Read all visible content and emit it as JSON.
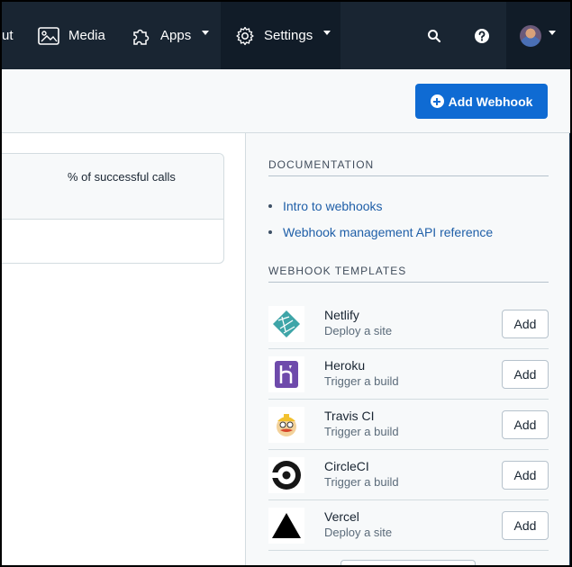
{
  "nav": {
    "partial_item_label": "ut",
    "media_label": "Media",
    "apps_label": "Apps",
    "settings_label": "Settings"
  },
  "header": {
    "add_webhook_label": "Add Webhook"
  },
  "table": {
    "column_header": "% of successful calls"
  },
  "documentation": {
    "title": "DOCUMENTATION",
    "links": [
      {
        "label": "Intro to webhooks"
      },
      {
        "label": "Webhook management API reference"
      }
    ]
  },
  "templates": {
    "title": "WEBHOOK TEMPLATES",
    "items": [
      {
        "name": "Netlify",
        "desc": "Deploy a site",
        "button": "Add",
        "icon": "netlify-icon"
      },
      {
        "name": "Heroku",
        "desc": "Trigger a build",
        "button": "Add",
        "icon": "heroku-icon"
      },
      {
        "name": "Travis CI",
        "desc": "Trigger a build",
        "button": "Add",
        "icon": "travis-ci-icon"
      },
      {
        "name": "CircleCI",
        "desc": "Trigger a build",
        "button": "Add",
        "icon": "circleci-icon"
      },
      {
        "name": "Vercel",
        "desc": "Deploy a site",
        "button": "Add",
        "icon": "vercel-icon"
      }
    ]
  },
  "colors": {
    "nav_bg": "#192532",
    "primary": "#0f6bd3",
    "link": "#1f5fa8"
  }
}
